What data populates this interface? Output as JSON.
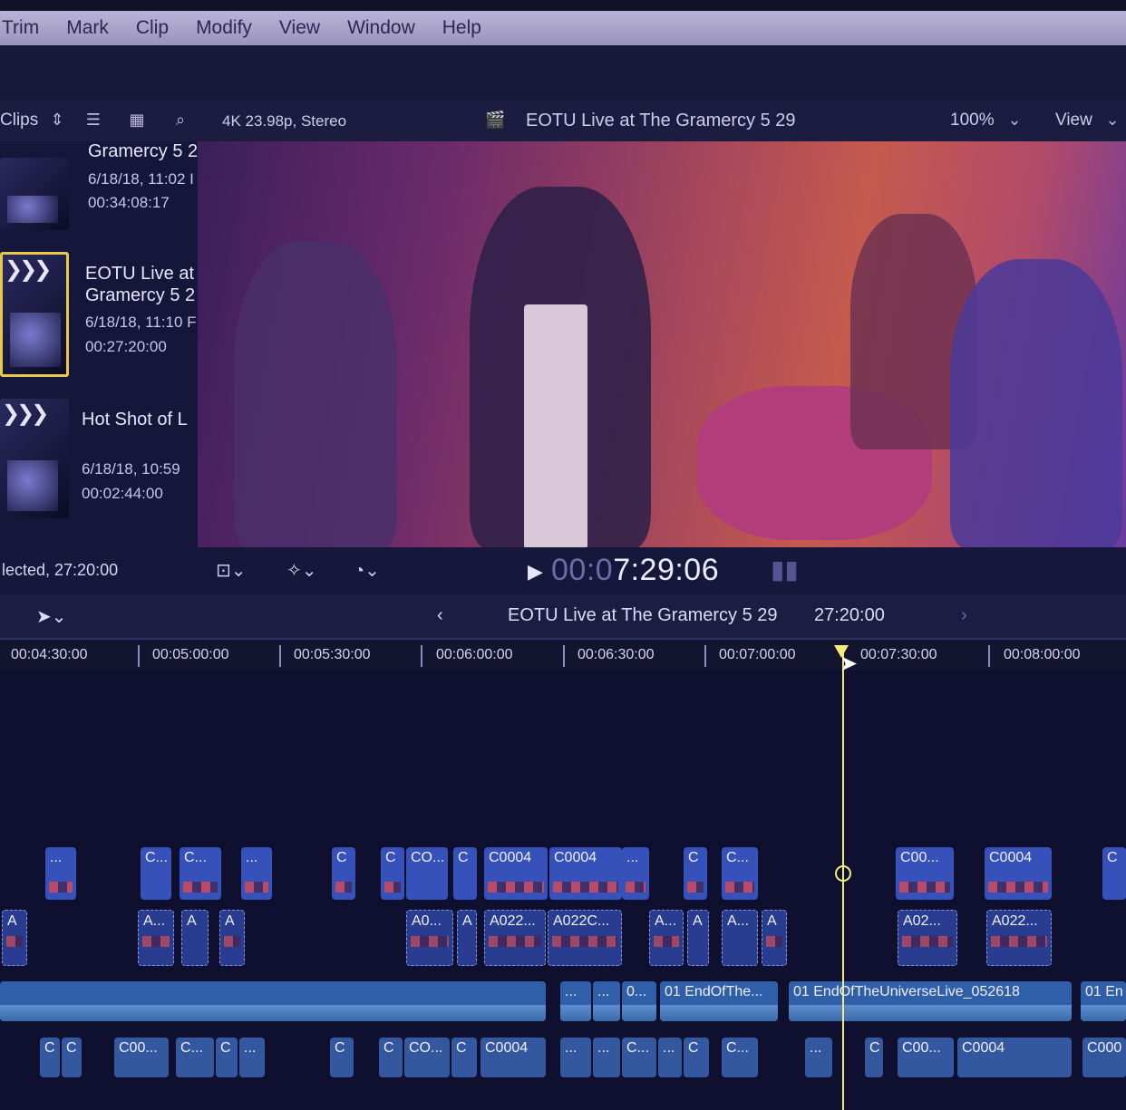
{
  "menu": [
    "Trim",
    "Mark",
    "Clip",
    "Modify",
    "View",
    "Window",
    "Help"
  ],
  "browser_header": {
    "label": "Clips"
  },
  "viewer_header": {
    "format": "4K 23.98p, Stereo",
    "title": "EOTU Live at The Gramercy 5 29",
    "zoom": "100%",
    "view": "View"
  },
  "clips": [
    {
      "name": "Gramercy 5 2",
      "date": "6/18/18, 11:02 I",
      "duration": "00:34:08:17"
    },
    {
      "name": "EOTU Live at",
      "name2": "Gramercy 5 2",
      "date": "6/18/18, 11:10 F",
      "duration": "00:27:20:00"
    },
    {
      "name": "Hot Shot of L",
      "date": "6/18/18, 10:59",
      "duration": "00:02:44:00"
    }
  ],
  "transport": {
    "selected": "lected, 27:20:00",
    "timecode_dim": "00:0",
    "timecode": "7:29:06"
  },
  "timeline_header": {
    "project": "EOTU Live at The Gramercy 5 29",
    "duration": "27:20:00"
  },
  "ruler": [
    "00:04:30:00",
    "00:05:00:00",
    "00:05:30:00",
    "00:06:00:00",
    "00:06:30:00",
    "00:07:00:00",
    "00:07:30:00",
    "00:08:00:00"
  ],
  "video_clips": [
    "...",
    "C...",
    "C...",
    "...",
    "C",
    "C",
    "CO...",
    "C",
    "C0004",
    "C0004",
    "...",
    "C",
    "C...",
    "C00...",
    "C0004",
    "C"
  ],
  "angle_clips": [
    "A",
    "A...",
    "A",
    "A",
    "A0...",
    "A",
    "A022...",
    "A022C...",
    "A...",
    "A",
    "A...",
    "A",
    "A02...",
    "A022..."
  ],
  "audio_clips": [
    "...",
    "...",
    "0...",
    "01 EndOfThe...",
    "01 EndOfTheUniverseLive_052618",
    "01 En"
  ],
  "bottom_clips": [
    "C",
    "C",
    "C00...",
    "C...",
    "C",
    "...",
    "C",
    "C",
    "CO...",
    "C",
    "C0004",
    "...",
    "...",
    "C...",
    "...",
    "C",
    "C...",
    "...",
    "C",
    "C00...",
    "C0004",
    "C000"
  ]
}
